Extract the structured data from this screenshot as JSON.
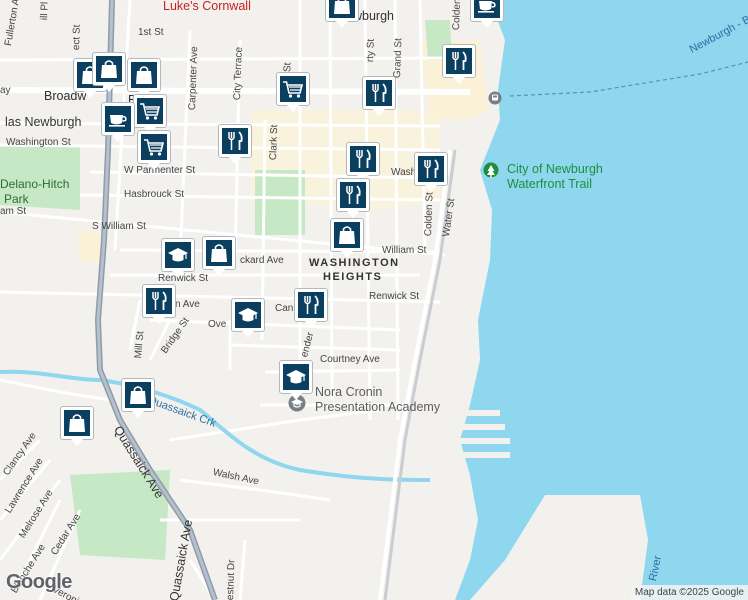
{
  "map": {
    "colors": {
      "water": "#8ed7ee",
      "land": "#f3f1ee",
      "park": "#c6e8c5",
      "highway": "#8d9cab",
      "commercial": "#fbf1d7",
      "marker": "#0b3f5f"
    }
  },
  "labels": {
    "lukes": "Luke's Cornwall",
    "newburgh": "Newburgh",
    "washington_heights_1": "WASHINGTON",
    "washington_heights_2": "HEIGHTS",
    "delano_1": "Delano-Hitch",
    "delano_2": "Park",
    "waterfront_1": "City of Newburgh",
    "waterfront_2": "Waterfront Trail",
    "nora_1": "Nora Cronin",
    "nora_2": "Presentation Academy",
    "newburgh_beacon": "Newburgh - Bea",
    "river": "River",
    "quassaick_crk": "Quassaick Crk",
    "las_newburgh": "las Newburgh"
  },
  "streets": {
    "first_st": "1st St",
    "broadway": "Broadw",
    "broadway_2": "B",
    "washington_st": "Washington St",
    "parmenter": "W Parmenter St",
    "hasbrouck": "Hasbrouck St",
    "s_william": "S William St",
    "william": "William St",
    "william_left": "am St",
    "renwick_st": "Renwick St",
    "renwick_left": "Renwick St",
    "packard": "ckard Ave",
    "courtney": "Courtney Ave",
    "carpenter": "Carpenter Ave",
    "city_terrace": "City Terrace",
    "clark_st": "Clark St",
    "grand_st": "Grand St",
    "liberty": "rty St",
    "colden": "Colden St",
    "colden_top": "Colden",
    "water_st": "Water St",
    "mill_st": "Mill St",
    "bridge_st": "Bridge St",
    "quassaick_ave": "Quassaick Ave",
    "quassaick_ave_2": "Quassaick Ave",
    "walsh": "Walsh Ave",
    "clancy": "Clancy Ave",
    "lawrence": "Lawrence Ave",
    "melrose": "Melrose Ave",
    "cedar": "Cedar Ave",
    "blanche": "Blanche Ave",
    "veronica": "Veronica Ave",
    "chestnut": "estnut Dr",
    "fullerton": "Fullerton Ave",
    "pill": "ill Pl",
    "ect_st": "ect St",
    "over": "Ove",
    "can": "Can",
    "ender": "ender",
    "en_ave": "n Ave",
    "r_st": "r St",
    "washing": "Washing",
    "ay": "ay"
  },
  "markers": [
    {
      "name": "shopping-bag",
      "icon": "shopping-bag"
    },
    {
      "name": "shopping-bag",
      "icon": "shopping-bag"
    },
    {
      "name": "shopping-bag",
      "icon": "shopping-bag"
    },
    {
      "name": "shopping-bag",
      "icon": "shopping-bag"
    },
    {
      "name": "shopping-bag",
      "icon": "shopping-bag"
    },
    {
      "name": "shopping-bag",
      "icon": "shopping-bag"
    },
    {
      "name": "shopping-bag",
      "icon": "shopping-bag"
    },
    {
      "name": "shopping-bag",
      "icon": "shopping-bag"
    },
    {
      "name": "shopping-cart",
      "icon": "shopping-cart"
    },
    {
      "name": "shopping-cart",
      "icon": "shopping-cart"
    },
    {
      "name": "shopping-cart",
      "icon": "shopping-cart"
    },
    {
      "name": "restaurant",
      "icon": "fork-knife"
    },
    {
      "name": "restaurant",
      "icon": "fork-knife"
    },
    {
      "name": "restaurant",
      "icon": "fork-knife"
    },
    {
      "name": "restaurant",
      "icon": "fork-knife"
    },
    {
      "name": "restaurant",
      "icon": "fork-knife"
    },
    {
      "name": "restaurant",
      "icon": "fork-knife"
    },
    {
      "name": "restaurant",
      "icon": "fork-knife"
    },
    {
      "name": "restaurant",
      "icon": "fork-knife"
    },
    {
      "name": "cafe",
      "icon": "coffee-cup"
    },
    {
      "name": "cafe",
      "icon": "coffee-cup"
    },
    {
      "name": "school",
      "icon": "graduation-cap"
    },
    {
      "name": "school",
      "icon": "graduation-cap"
    },
    {
      "name": "school",
      "icon": "graduation-cap"
    }
  ],
  "footer": {
    "logo": "Google",
    "attribution": "Map data ©2025 Google"
  }
}
